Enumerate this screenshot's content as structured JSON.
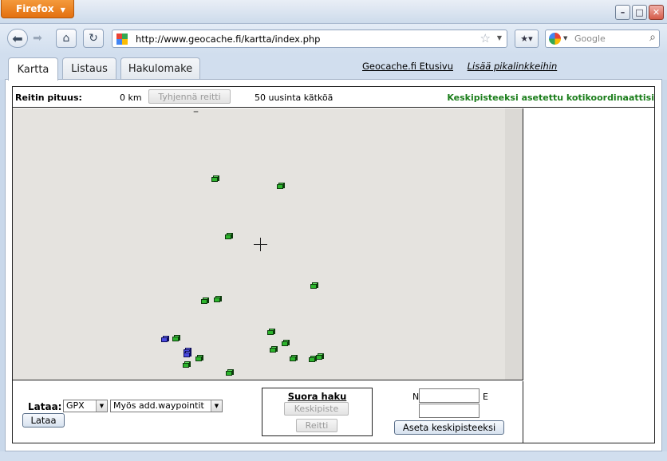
{
  "browser": {
    "menu_label": "Firefox",
    "url": "http://www.geocache.fi/kartta/index.php",
    "search_placeholder": "Google"
  },
  "tabs": {
    "items": [
      {
        "label": "Kartta",
        "active": true
      },
      {
        "label": "Listaus",
        "active": false
      },
      {
        "label": "Hakulomake",
        "active": false
      }
    ],
    "link_home": "Geocache.fi Etusivu",
    "link_quick": "Lisää pikalinkkeihin"
  },
  "route": {
    "label": "Reitin pituus:",
    "length": "0 km",
    "clear_label": "Tyhjennä reitti",
    "count_text": "50 uusinta kätköä",
    "status": "Keskipisteeksi asetettu kotikoordinaattisi"
  },
  "map": {
    "marker_colors": {
      "cache": "#2db52d",
      "own": "#4a4ae0"
    }
  },
  "download": {
    "label": "Lataa:",
    "format_value": "GPX",
    "waypoints_value": "Myös add.waypointit",
    "button": "Lataa"
  },
  "direct_search": {
    "title": "Suora haku",
    "center_button": "Keskipiste",
    "route_button": "Reitti"
  },
  "coords": {
    "n_label": "N",
    "e_label": "E",
    "n_value": "",
    "e_value": "",
    "set_button": "Aseta keskipisteeksi"
  }
}
